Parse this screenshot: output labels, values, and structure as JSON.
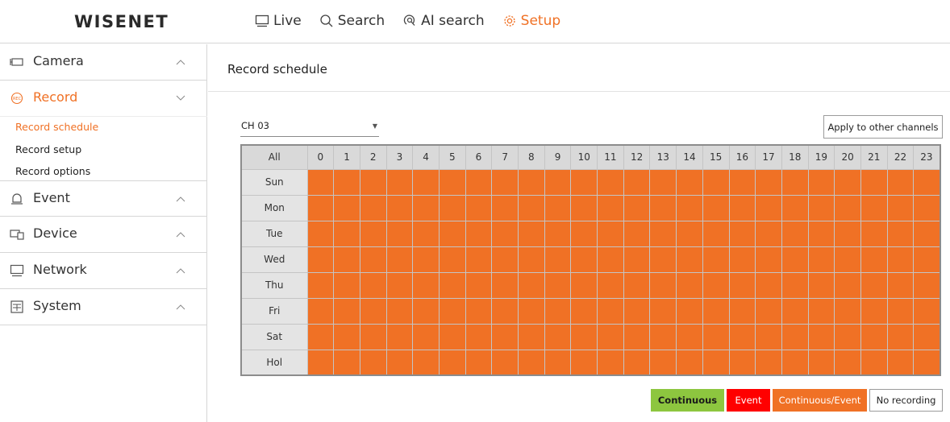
{
  "header": {
    "logo": "WISENET",
    "nav": [
      {
        "label": "Live",
        "icon": "monitor-icon",
        "active": false
      },
      {
        "label": "Search",
        "icon": "search-icon",
        "active": false
      },
      {
        "label": "AI search",
        "icon": "ai-search-icon",
        "active": false
      },
      {
        "label": "Setup",
        "icon": "gear-icon",
        "active": true
      }
    ]
  },
  "sidebar": {
    "groups": [
      {
        "label": "Camera",
        "icon": "camera-icon",
        "expanded": false
      },
      {
        "label": "Record",
        "icon": "rec-icon",
        "expanded": true,
        "active": true
      },
      {
        "label": "Event",
        "icon": "bell-icon",
        "expanded": false
      },
      {
        "label": "Device",
        "icon": "device-icon",
        "expanded": false
      },
      {
        "label": "Network",
        "icon": "network-monitor-icon",
        "expanded": false
      },
      {
        "label": "System",
        "icon": "system-icon",
        "expanded": false
      }
    ],
    "record_items": [
      {
        "label": "Record schedule",
        "active": true
      },
      {
        "label": "Record setup",
        "active": false
      },
      {
        "label": "Record options",
        "active": false
      }
    ]
  },
  "main": {
    "title": "Record schedule",
    "channel": "CH 03",
    "apply_button": "Apply to other channels",
    "schedule": {
      "all_label": "All",
      "hours": [
        "0",
        "1",
        "2",
        "3",
        "4",
        "5",
        "6",
        "7",
        "8",
        "9",
        "10",
        "11",
        "12",
        "13",
        "14",
        "15",
        "16",
        "17",
        "18",
        "19",
        "20",
        "21",
        "22",
        "23"
      ],
      "days": [
        "Sun",
        "Mon",
        "Tue",
        "Wed",
        "Thu",
        "Fri",
        "Sat",
        "Hol"
      ],
      "fill_mode": "Continuous/Event"
    },
    "legend": [
      {
        "label": "Continuous",
        "color": "#8dc63f",
        "text_color": "#1a1a1a",
        "bold": true
      },
      {
        "label": "Event",
        "color": "#ff0000",
        "text_color": "#ffffff",
        "bold": false
      },
      {
        "label": "Continuous/Event",
        "color": "#f07125",
        "text_color": "#ffffff",
        "bold": false
      },
      {
        "label": "No recording",
        "color": "#ffffff",
        "text_color": "#222222",
        "bold": false
      }
    ]
  },
  "colors": {
    "accent": "#f07125",
    "grid_header": "#d9d9d9",
    "day_cell": "#e4e4e4"
  }
}
